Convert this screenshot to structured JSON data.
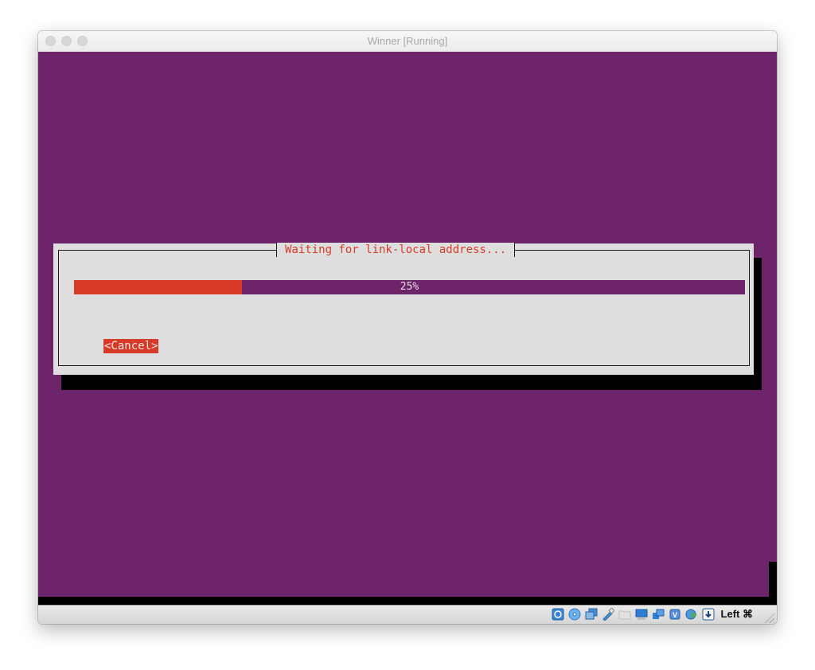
{
  "window": {
    "title": "Winner [Running]",
    "controls": [
      "close",
      "minimize",
      "zoom"
    ]
  },
  "vm_screen": {
    "background_color": "#6e246b",
    "dialog": {
      "title": "Waiting for link-local address...",
      "progress": {
        "percent": 25,
        "label": "25%",
        "fill_color": "#d83a29"
      },
      "cancel_label": "<Cancel>"
    }
  },
  "statusbar": {
    "icons": [
      {
        "name": "hard-disk-icon"
      },
      {
        "name": "optical-drive-icon"
      },
      {
        "name": "audio-icon"
      },
      {
        "name": "usb-icon"
      },
      {
        "name": "shared-folders-icon"
      },
      {
        "name": "display-icon"
      },
      {
        "name": "video-capture-icon"
      },
      {
        "name": "cpu-virtualization-icon"
      },
      {
        "name": "network-icon"
      },
      {
        "name": "mouse-integration-icon"
      }
    ],
    "host_key": "Left ⌘"
  }
}
